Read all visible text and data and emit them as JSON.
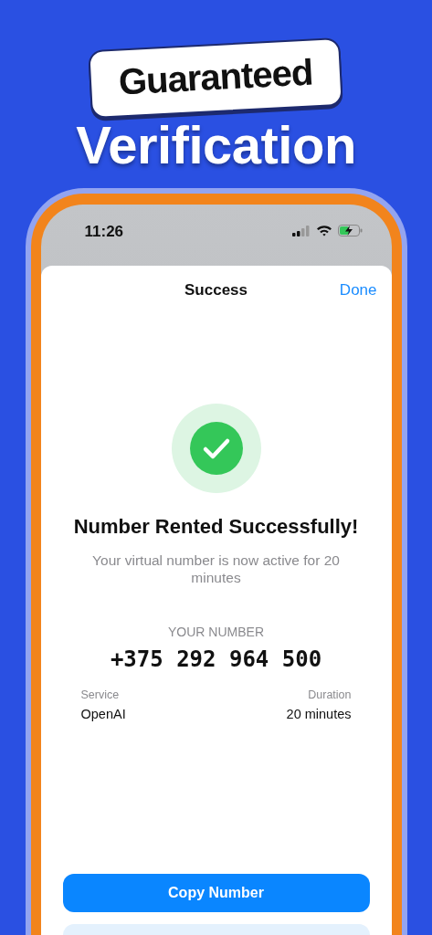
{
  "headline": {
    "badge": "Guaranteed",
    "title": "Verification"
  },
  "status_bar": {
    "time": "11:26"
  },
  "sheet": {
    "title": "Success",
    "done": "Done"
  },
  "result": {
    "title": "Number Rented Successfully!",
    "subtitle": "Your virtual number is now active for 20 minutes"
  },
  "number": {
    "label": "YOUR NUMBER",
    "value": "+375 292 964 500"
  },
  "details": [
    {
      "label": "Service",
      "value": "OpenAI"
    },
    {
      "label": "Duration",
      "value": "20 minutes"
    }
  ],
  "buttons": [
    {
      "label": "Copy Number",
      "kind": "primary"
    },
    {
      "kind": "secondary"
    }
  ]
}
